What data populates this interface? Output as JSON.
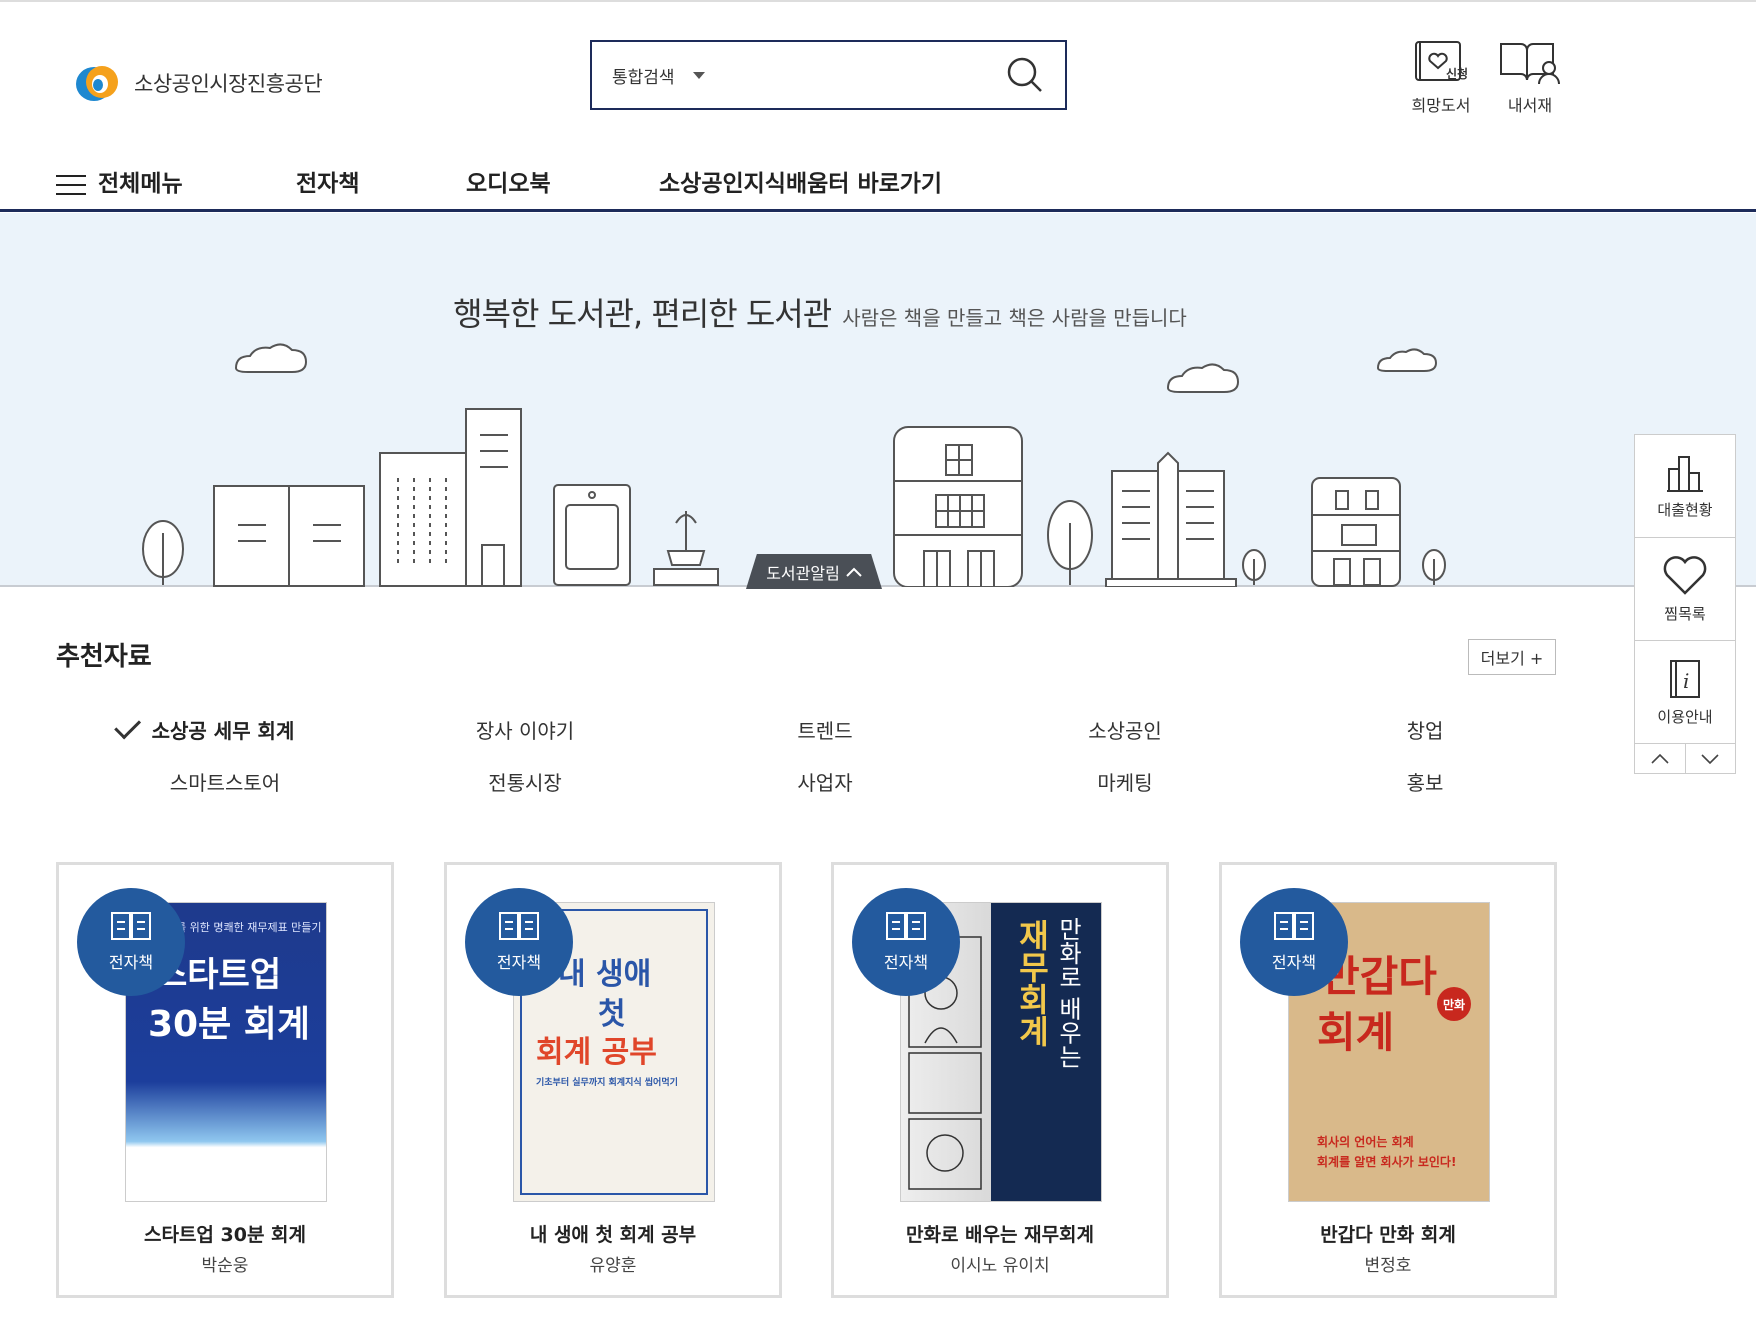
{
  "header": {
    "logo_text": "소상공인시장진흥공단",
    "search": {
      "scope": "통합검색",
      "placeholder": ""
    },
    "utils": [
      {
        "label": "희망도서",
        "icon_badge": "신청"
      },
      {
        "label": "내서재"
      }
    ]
  },
  "gnb": {
    "all_menu": "전체메뉴",
    "items": [
      "전자책",
      "오디오북",
      "소상공인지식배움터 바로가기"
    ]
  },
  "banner": {
    "title": "행복한 도서관, 편리한 도서관",
    "subtitle": "사람은 책을 만들고 책은 사람을 만듭니다",
    "notice_tab": "도서관알림"
  },
  "quick_menu": {
    "items": [
      "대출현황",
      "찜목록",
      "이용안내"
    ]
  },
  "recommend": {
    "title": "추천자료",
    "more": "더보기 +",
    "categories_row1": [
      "소상공 세무 회계",
      "장사 이야기",
      "트렌드",
      "소상공인",
      "창업"
    ],
    "categories_row2": [
      "스마트스토어",
      "전통시장",
      "사업자",
      "마케팅",
      "홍보"
    ],
    "active_category": "소상공 세무 회계",
    "books": [
      {
        "badge": "전자책",
        "title": "스타트업 30분 회계",
        "author": "박순웅",
        "cover": {
          "line1": "스타트업",
          "line2": "30분 회계",
          "top_text": "를 위한 명쾌한 재무제표 만들기",
          "bg": "#1f3a8f"
        }
      },
      {
        "badge": "전자책",
        "title": "내 생애 첫 회계 공부",
        "author": "유양훈",
        "cover": {
          "line1": "내 생애",
          "line2": "첫",
          "line3": "회계 공부",
          "sub": "기초부터 실무까지 회계지식 씹어먹기",
          "bg": "#f4f1ea"
        }
      },
      {
        "badge": "전자책",
        "title": "만화로 배우는 재무회계",
        "author": "이시노 유이치",
        "cover": {
          "line1": "재무회계",
          "line2": "만화로 배우는",
          "bg": "#142a52"
        }
      },
      {
        "badge": "전자책",
        "title": "반갑다 만화 회계",
        "author": "변정호",
        "cover": {
          "line1": "반갑다",
          "line2": "회계",
          "tag": "만화",
          "sub1": "회사의 언어는 회계",
          "sub2": "회계를 알면 회사가 보인다!",
          "bg": "#d9b98a"
        }
      }
    ]
  }
}
